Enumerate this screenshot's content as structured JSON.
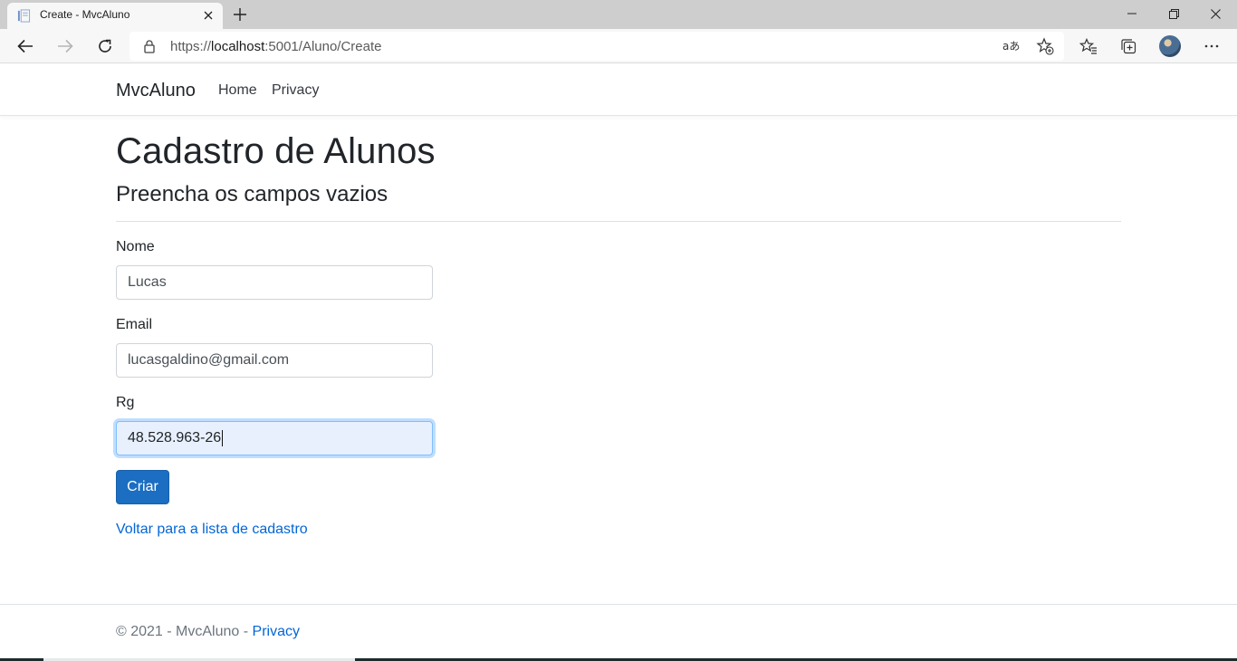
{
  "browser": {
    "tab_title": "Create - MvcAluno",
    "url_scheme": "https://",
    "url_host": "localhost",
    "url_rest": ":5001/Aluno/Create",
    "icons": [
      "tab-favicon",
      "close-icon",
      "plus-icon",
      "minimize-icon",
      "restore-icon",
      "close-window-icon",
      "back-arrow-icon",
      "forward-arrow-icon",
      "refresh-icon",
      "lock-icon",
      "read-aloud-icon",
      "add-favorite-icon",
      "favorites-icon",
      "collections-icon",
      "profile-avatar",
      "more-icon"
    ]
  },
  "navbar": {
    "brand": "MvcAluno",
    "links": [
      "Home",
      "Privacy"
    ]
  },
  "page": {
    "title": "Cadastro de Alunos",
    "subtitle": "Preencha os campos vazios"
  },
  "form": {
    "nome_label": "Nome",
    "nome_value": "Lucas",
    "email_label": "Email",
    "email_value": "lucasgaldino@gmail.com",
    "rg_label": "Rg",
    "rg_value": "48.528.963-26",
    "submit_label": "Criar",
    "back_link": "Voltar para a lista de cadastro"
  },
  "footer": {
    "copyright": "© 2021 - MvcAluno - ",
    "privacy_link": "Privacy"
  },
  "colors": {
    "primary_button": "#1b6ec2",
    "link": "#0366d6",
    "focus_field_bg": "#e8f0fe"
  }
}
